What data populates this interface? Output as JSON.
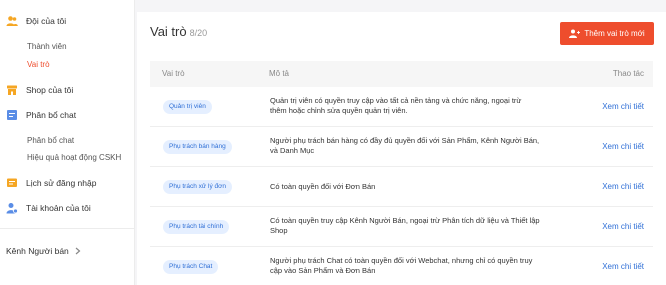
{
  "sidebar": {
    "team": {
      "title": "Đội của tôi",
      "items": [
        "Thành viên",
        "Vai trò"
      ]
    },
    "shop": {
      "title": "Shop của tôi"
    },
    "chat": {
      "title": "Phân bổ chat",
      "items": [
        "Phân bổ chat",
        "Hiệu quả hoạt động CSKH"
      ]
    },
    "login_history": {
      "title": "Lịch sử đăng nhập"
    },
    "account": {
      "title": "Tài khoản của tôi"
    },
    "seller_channel": "Kênh Người bán"
  },
  "header": {
    "title": "Vai trò",
    "count": "8/20",
    "add_button": "Thêm vai trò mới"
  },
  "table": {
    "columns": [
      "Vai trò",
      "Mô tả",
      "Thao tác"
    ],
    "rows": [
      {
        "role": "Quản trị viên",
        "desc": "Quản trị viên có quyền truy cập vào tất cả nền tảng và chức năng, ngoại trừ thêm hoặc chỉnh sửa quyền quản trị viên.",
        "action": "Xem chi tiết"
      },
      {
        "role": "Phụ trách bán hàng",
        "desc": "Người phụ trách bán hàng có đầy đủ quyền đối với Sản Phẩm, Kênh Người Bán, và Danh Mục",
        "action": "Xem chi tiết"
      },
      {
        "role": "Phụ trách xử lý đơn",
        "desc": "Có toàn quyền đối với Đơn Bán",
        "action": "Xem chi tiết"
      },
      {
        "role": "Phụ trách tài chính",
        "desc": "Có toàn quyền truy cập Kênh Người Bán, ngoại trừ Phân tích dữ liệu và Thiết lập Shop",
        "action": "Xem chi tiết"
      },
      {
        "role": "Phụ trách Chat",
        "desc": "Người phụ trách Chat có toàn quyền đối với Webchat, nhưng chỉ có quyền truy cập vào Sản Phẩm và Đơn Bán",
        "action": "Xem chi tiết"
      }
    ]
  },
  "colors": {
    "accent": "#ee4d2d",
    "icon_orange": "#f5a623",
    "link_blue": "#2f6fd6"
  }
}
